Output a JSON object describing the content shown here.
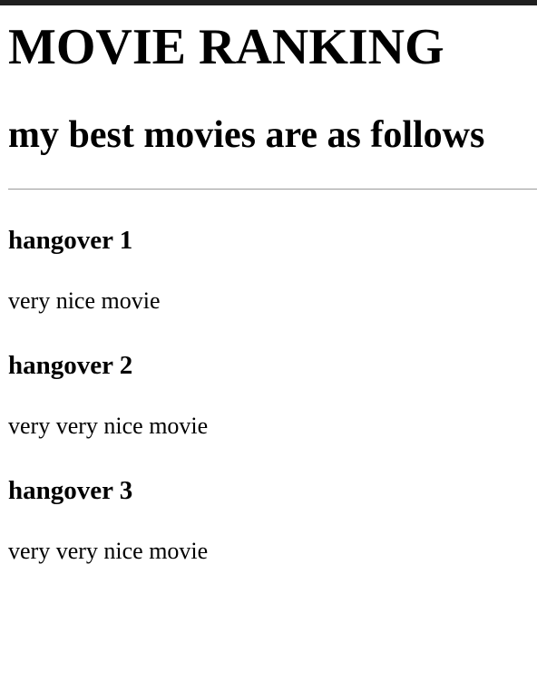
{
  "page": {
    "title": "MOVIE RANKING",
    "subtitle": "my best movies are as follows"
  },
  "movies": [
    {
      "title": "hangover 1",
      "description": "very nice movie"
    },
    {
      "title": "hangover 2",
      "description": "very very nice movie"
    },
    {
      "title": "hangover 3",
      "description": "very very nice movie"
    }
  ],
  "colors": {
    "top_strip": "#202020",
    "divider": "#9a9a9a",
    "text": "#000000",
    "background": "#ffffff"
  }
}
